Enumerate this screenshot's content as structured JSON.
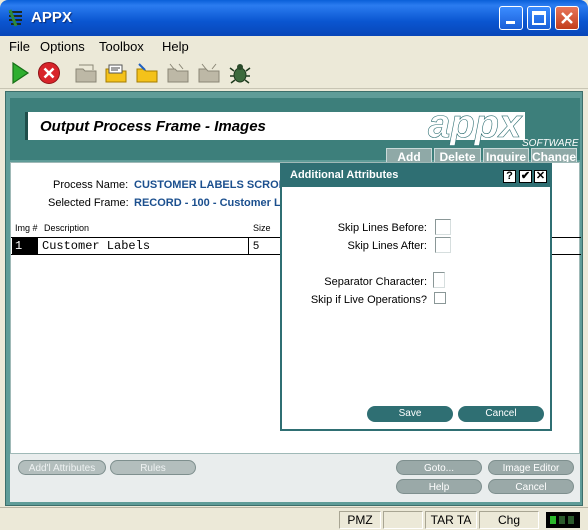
{
  "window": {
    "title": "APPX"
  },
  "menu": [
    "File",
    "Options",
    "Toolbox",
    "Help"
  ],
  "toolbar": {
    "icons": [
      "run-icon",
      "stop-icon",
      "folder-icon",
      "edit-folder-icon",
      "open-folder-icon",
      "disabled-folder-icon",
      "disabled-folder2-icon",
      "bug-icon"
    ]
  },
  "frame": {
    "title": "Output Process Frame - Images",
    "tabs": [
      "Add",
      "Delete",
      "Inquire",
      "Change"
    ],
    "logo_text": "appx",
    "logo_sub": "SOFTWARE"
  },
  "form": {
    "process_name_label": "Process Name:",
    "process_name_value": "CUSTOMER LABELS SCROL",
    "selected_frame_label": "Selected Frame:",
    "selected_frame_value": "RECORD - 100 - Customer L"
  },
  "grid": {
    "columns": [
      "Img #",
      "Description",
      "Size"
    ],
    "rows": [
      {
        "img": "1",
        "description": "Customer Labels",
        "size": "5"
      }
    ]
  },
  "bottom_buttons": {
    "add_attributes": "Add'l Attributes",
    "rules": "Rules",
    "goto": "Goto...",
    "image_editor": "Image Editor",
    "help": "Help",
    "cancel": "Cancel"
  },
  "dialog": {
    "title": "Additional Attributes",
    "help_btn": "?",
    "ok_btn": "✔",
    "close_btn": "✕",
    "skip_before_label": "Skip Lines Before:",
    "skip_after_label": "Skip Lines After:",
    "separator_label": "Separator Character:",
    "skip_live_label": "Skip if Live Operations?",
    "save": "Save",
    "cancel": "Cancel"
  },
  "status": {
    "pmz": "PMZ",
    "tar": "TAR TA",
    "mode": "Chg"
  },
  "colors": {
    "accent": "#2f6f73",
    "frame": "#5f9c98",
    "link": "#1b4f8e"
  }
}
